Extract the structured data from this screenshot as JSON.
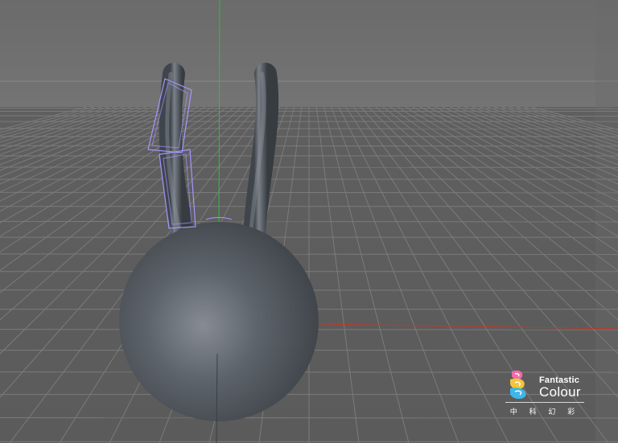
{
  "watermark": {
    "title": "Fantastic",
    "subtitle": "Colour",
    "chinese": "中 科 幻 彩",
    "logo_icon": "stacked-wave-logo-icon"
  },
  "colors": {
    "sky": "#6e6e6e",
    "floor": "#5a5a5a",
    "grid": "#777777",
    "object": "#565c63",
    "selection": "#9b8cff",
    "axis_y": "#2fbf3f",
    "axis_x": "#d23a2a"
  }
}
